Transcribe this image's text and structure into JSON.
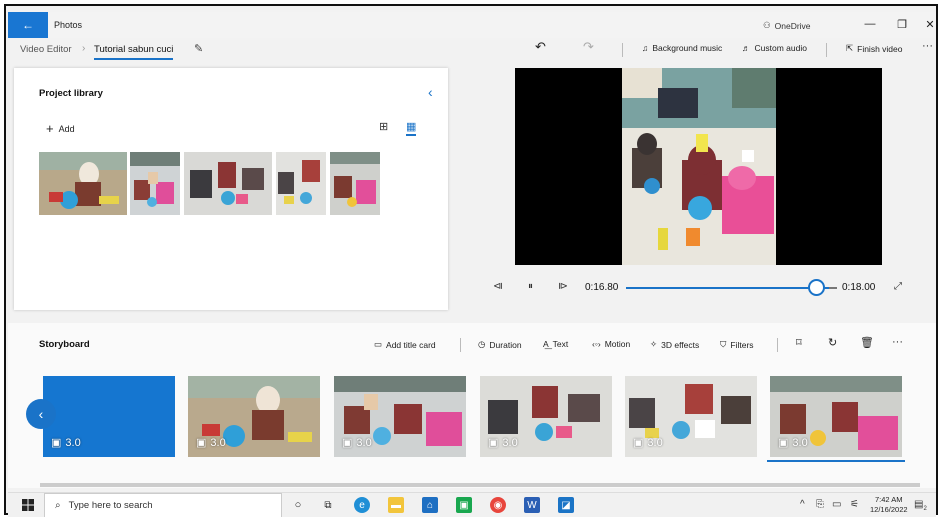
{
  "app": {
    "title": "Photos",
    "onedrive_label": "OneDrive"
  },
  "window_buttons": {
    "minimize": "—",
    "maximize": "❐",
    "close": "✕"
  },
  "breadcrumb": {
    "root": "Video Editor",
    "project": "Tutorial sabun cuci"
  },
  "toolbar": {
    "background_music": "Background music",
    "custom_audio": "Custom audio",
    "finish_video": "Finish video",
    "more": "···"
  },
  "library": {
    "title": "Project library",
    "add_label": "Add"
  },
  "player": {
    "current_time": "0:16.80",
    "total_time": "0:18.00",
    "progress": 0.933
  },
  "storyboard": {
    "title": "Storyboard",
    "tools": {
      "add_title_card": "Add title card",
      "duration": "Duration",
      "text": "Text",
      "motion": "Motion",
      "effects_3d": "3D effects",
      "filters": "Filters",
      "more": "···"
    },
    "clips": [
      {
        "duration": "3.0",
        "kind": "title-card"
      },
      {
        "duration": "3.0",
        "kind": "photo"
      },
      {
        "duration": "3.0",
        "kind": "photo"
      },
      {
        "duration": "3.0",
        "kind": "photo"
      },
      {
        "duration": "3.0",
        "kind": "photo"
      },
      {
        "duration": "3.0",
        "kind": "photo",
        "selected": true
      }
    ]
  },
  "taskbar": {
    "search_placeholder": "Type here to search",
    "time": "7:42 AM",
    "date": "12/16/2022",
    "notif_count": "2"
  },
  "colors": {
    "accent": "#1a73c8",
    "title_card": "#1576d0",
    "back_button": "#1976d2"
  }
}
